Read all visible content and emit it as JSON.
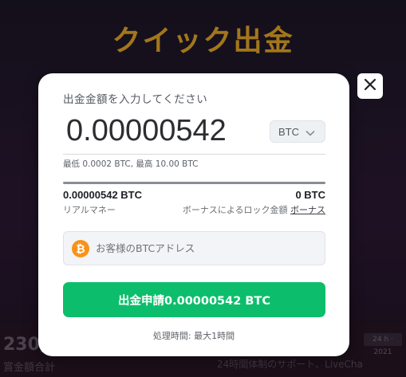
{
  "page": {
    "title": "クイック出金"
  },
  "background": {
    "left_number": "230,",
    "left_subtext": "賞金額合計",
    "right_text": "24時間体制のサポート、LiveCha",
    "right_tag": "24 h · 2021"
  },
  "modal": {
    "amount_label": "出金金額を入力してください",
    "amount_value": "0.00000542",
    "currency": "BTC",
    "limits_text": "最低 0.0002 BTC, 最高 10.00 BTC",
    "real_money_value": "0.00000542 BTC",
    "real_money_label": "リアルマネー",
    "bonus_value": "0 BTC",
    "bonus_label": "ボーナスによるロック金額",
    "bonus_link": "ボーナス",
    "address_placeholder": "お客様のBTCアドレス",
    "btc_symbol": "₿",
    "submit_label": "出金申請0.00000542 BTC",
    "processing_time": "処理時間: 最大1時間",
    "real_money_fraction": 1.0
  },
  "colors": {
    "accent_title": "#f5b323",
    "submit_green": "#0cbe6b",
    "btc_orange": "#f7931a"
  },
  "icons": {
    "close": "close-icon",
    "chevron": "chevron-down-icon",
    "btc": "bitcoin-icon"
  }
}
